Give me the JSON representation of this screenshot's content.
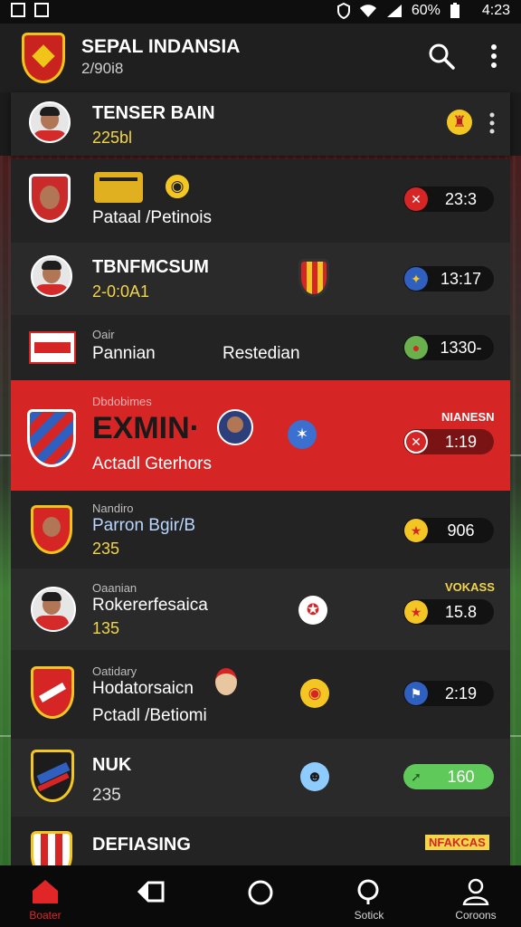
{
  "status_bar": {
    "battery": "60%",
    "time": "4:23"
  },
  "header": {
    "title": "SEPAL INDANSIA",
    "subtitle": "2/90i8"
  },
  "featured": {
    "name": "TENSER BAIN",
    "value": "225bl"
  },
  "rows": [
    {
      "name": "Pataal /Petinois",
      "score": "23:3"
    },
    {
      "name": "TBNFMCSUM",
      "value": "2-0:0A1",
      "score": "13:17"
    },
    {
      "small": "Oair",
      "name_left": "Pannian",
      "name_right": "Restedian",
      "score": "1330-"
    },
    {
      "small": "Dbdobimes",
      "name": "EXMIN·",
      "sub": "Actadl Gterhors",
      "tag": "NIANESN",
      "score": "1:19"
    },
    {
      "small": "Nandiro",
      "name": "Parron Bgir/B",
      "value": "235",
      "score": "906"
    },
    {
      "small": "Oaanian",
      "name": "Rokererfesaica",
      "value": "135",
      "tag": "VOKASS",
      "score": "15.8"
    },
    {
      "small": "Oatidary",
      "name": "Hodatorsaicn",
      "sub": "Pctadl /Betiomi",
      "score": "2:19"
    },
    {
      "name": "NUK",
      "value": "235",
      "score": "160"
    },
    {
      "name": "DEFIASING",
      "tag": "NFAKCAS"
    }
  ],
  "nav": {
    "home": "Boater",
    "search": "Sotick",
    "account": "Coroons"
  },
  "colors": {
    "accent_red": "#d62525",
    "yellow": "#f3d54a",
    "green": "#5fc95a"
  }
}
